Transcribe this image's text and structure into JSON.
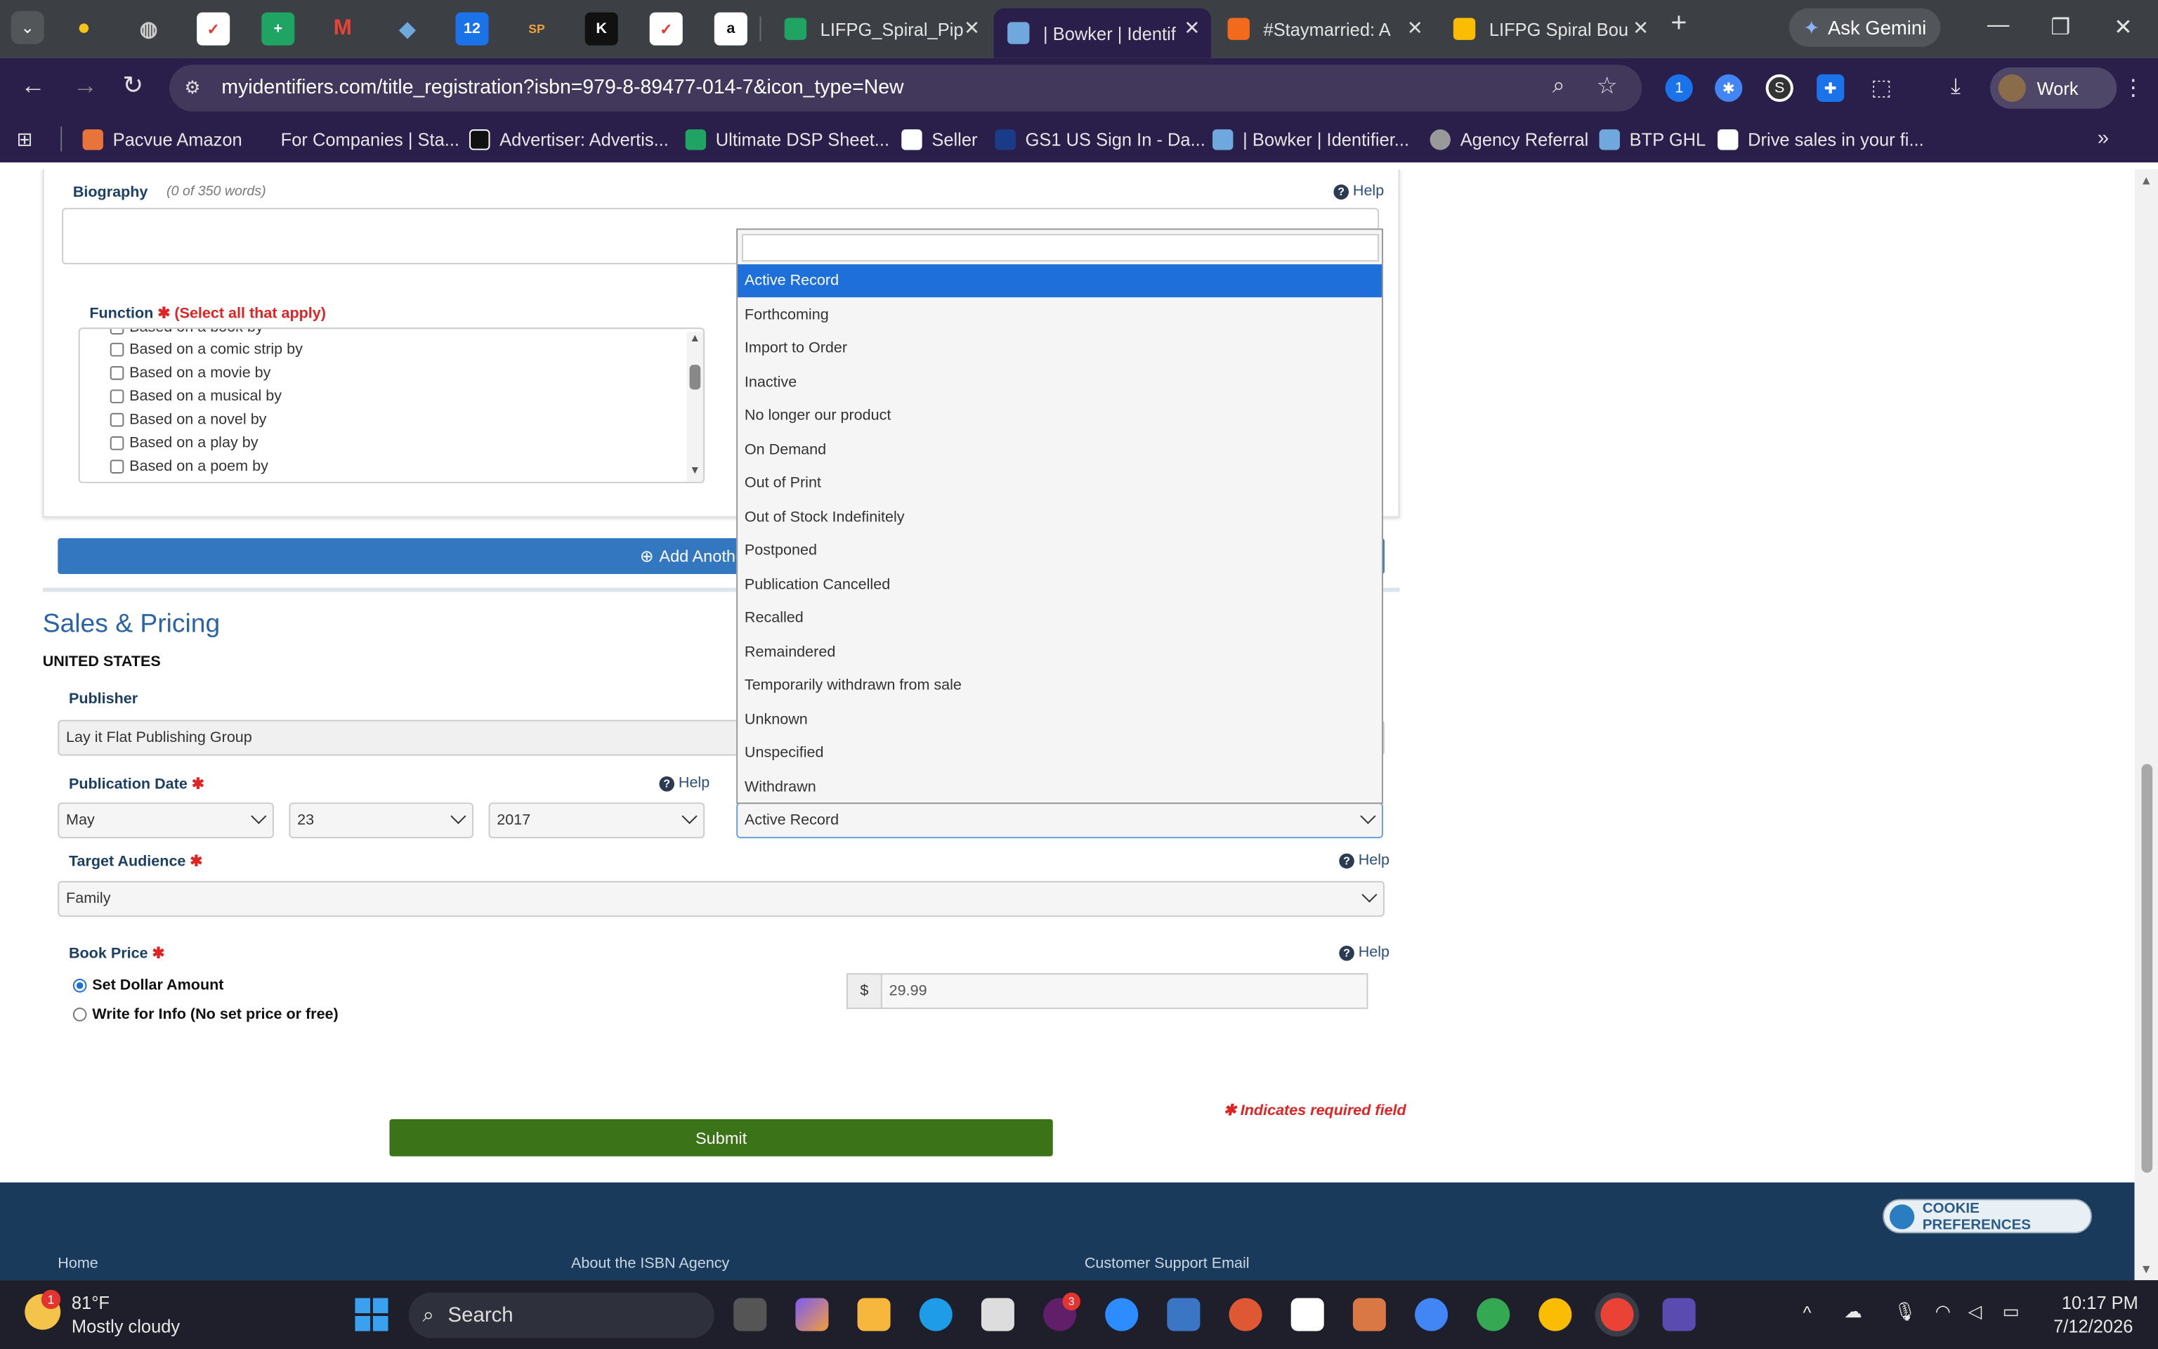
{
  "browser": {
    "tabs": [
      {
        "title": "LIFPG_Spiral_Pipi",
        "active": false
      },
      {
        "title": "| Bowker | Identif",
        "active": true
      },
      {
        "title": "#Staymarried: A",
        "active": false
      },
      {
        "title": "LIFPG Spiral Bou",
        "active": false
      }
    ],
    "pinned_badge": "12",
    "pinned_sp": "SP",
    "pinned_k": "K",
    "new_tab": "+",
    "gemini": "Ask Gemini",
    "url": "myidentifiers.com/title_registration?isbn=979-8-89477-014-7&icon_type=New",
    "profile": "Work",
    "bookmarks": [
      "Pacvue Amazon",
      "For Companies | Sta...",
      "Advertiser: Advertis...",
      "Ultimate DSP Sheet...",
      "Seller",
      "GS1 US Sign In - Da...",
      "| Bowker | Identifier...",
      "Agency Referral",
      "BTP GHL",
      "Drive sales in your fi..."
    ]
  },
  "form": {
    "biography_label": "Biography",
    "biography_count": "(0 of 350 words)",
    "help": "Help",
    "function_label": "Function",
    "function_hint": "(Select all that apply)",
    "function_items": [
      "Based on a book by",
      "Based on a comic strip by",
      "Based on a movie by",
      "Based on a musical by",
      "Based on a novel by",
      "Based on a play by",
      "Based on a poem by"
    ],
    "add_author": "Add Another Author",
    "sales_heading": "Sales & Pricing",
    "country": "UNITED STATES",
    "publisher_label": "Publisher",
    "publisher_value": "Lay it Flat Publishing Group",
    "pubdate_label": "Publication Date",
    "pub_month": "May",
    "pub_day": "23",
    "pub_year": "2017",
    "status_value": "Active Record",
    "audience_label": "Target Audience",
    "audience_value": "Family",
    "price_label": "Book Price",
    "price_option1": "Set Dollar Amount",
    "price_option2": "Write for Info (No set price or free)",
    "currency": "$",
    "price_value": "29.99",
    "required_note": "Indicates required field",
    "submit": "Submit"
  },
  "status_dropdown": {
    "options": [
      "Active Record",
      "Forthcoming",
      "Import to Order",
      "Inactive",
      "No longer our product",
      "On Demand",
      "Out of Print",
      "Out of Stock Indefinitely",
      "Postponed",
      "Publication Cancelled",
      "Recalled",
      "Remaindered",
      "Temporarily withdrawn from sale",
      "Unknown",
      "Unspecified",
      "Withdrawn"
    ],
    "selected": "Active Record"
  },
  "footer": {
    "cookie": "COOKIE PREFERENCES",
    "links": [
      "Home",
      "About the ISBN Agency",
      "Customer Support Email"
    ]
  },
  "taskbar": {
    "weather_badge": "1",
    "temp": "81°F",
    "condition": "Mostly cloudy",
    "search": "Search",
    "slack_badge": "3",
    "time": "10:17 PM",
    "date": "7/12/2026"
  },
  "colors": {
    "chrome": "#2a1e4a",
    "tabstrip": "#3c3f44",
    "link_blue": "#2a63a6",
    "highlight": "#1e6fd9",
    "submit_green": "#3a7318",
    "footer": "#193a5a"
  }
}
